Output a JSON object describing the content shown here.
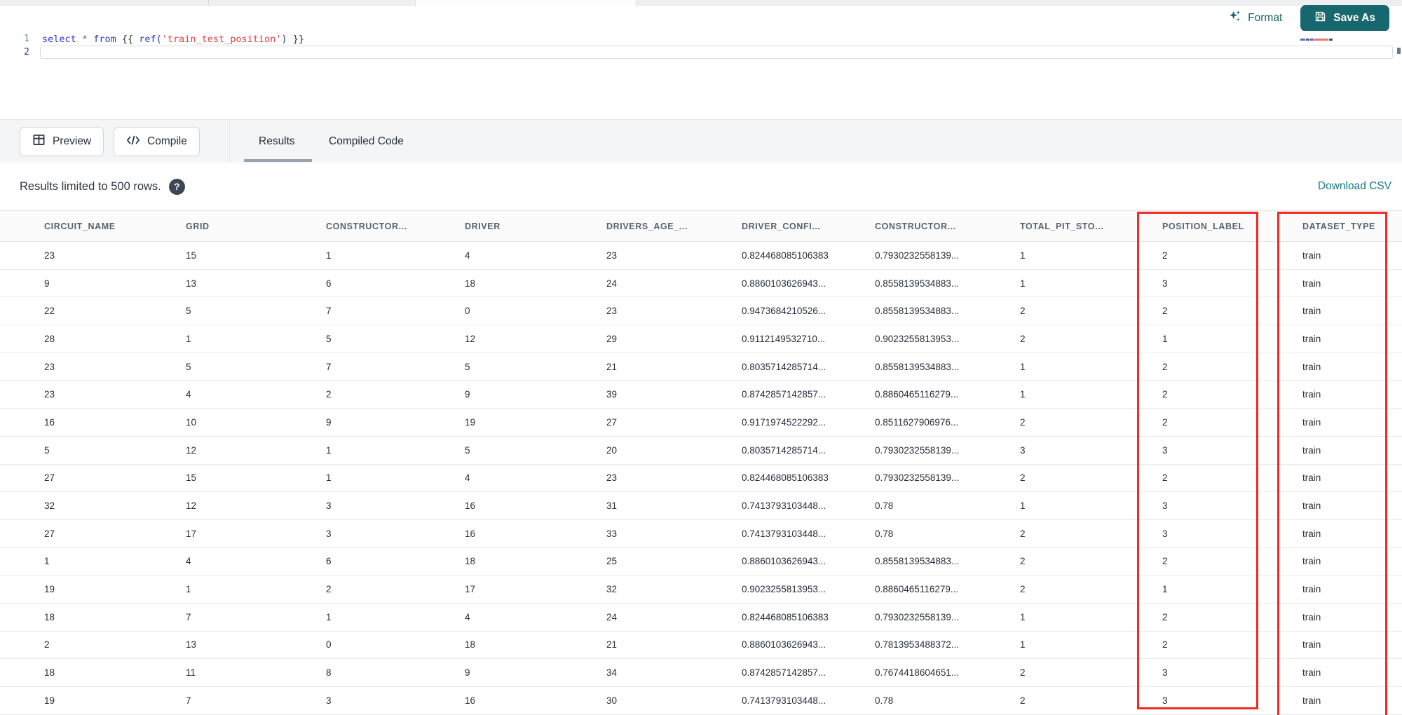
{
  "toolbar": {
    "format_label": "Format",
    "save_as_label": "Save As"
  },
  "editor": {
    "line1_number": "1",
    "line2_number": "2",
    "code_tokens": [
      {
        "text": "select",
        "type": "keyword"
      },
      {
        "text": " ",
        "type": "plain"
      },
      {
        "text": "*",
        "type": "operator"
      },
      {
        "text": " ",
        "type": "plain"
      },
      {
        "text": "from",
        "type": "keyword"
      },
      {
        "text": " {{ ",
        "type": "plain"
      },
      {
        "text": "ref(",
        "type": "keyword"
      },
      {
        "text": "'train_test_position'",
        "type": "string"
      },
      {
        "text": ")",
        "type": "plain"
      },
      {
        "text": " }}",
        "type": "plain"
      }
    ]
  },
  "results_bar": {
    "preview_label": "Preview",
    "compile_label": "Compile",
    "tabs": [
      {
        "label": "Results",
        "active": true
      },
      {
        "label": "Compiled Code",
        "active": false
      }
    ]
  },
  "info_bar": {
    "message": "Results limited to 500 rows.",
    "help_icon": "?",
    "download_label": "Download CSV"
  },
  "table": {
    "columns": [
      "CIRCUIT_NAME",
      "GRID",
      "CONSTRUCTOR...",
      "DRIVER",
      "DRIVERS_AGE_...",
      "DRIVER_CONFI...",
      "CONSTRUCTOR...",
      "TOTAL_PIT_STO...",
      "POSITION_LABEL",
      "DATASET_TYPE"
    ],
    "rows": [
      [
        "23",
        "15",
        "1",
        "4",
        "23",
        "0.824468085106383",
        "0.7930232558139...",
        "1",
        "2",
        "train"
      ],
      [
        "9",
        "13",
        "6",
        "18",
        "24",
        "0.8860103626943...",
        "0.8558139534883...",
        "1",
        "3",
        "train"
      ],
      [
        "22",
        "5",
        "7",
        "0",
        "23",
        "0.9473684210526...",
        "0.8558139534883...",
        "2",
        "2",
        "train"
      ],
      [
        "28",
        "1",
        "5",
        "12",
        "29",
        "0.9112149532710...",
        "0.9023255813953...",
        "2",
        "1",
        "train"
      ],
      [
        "23",
        "5",
        "7",
        "5",
        "21",
        "0.8035714285714...",
        "0.8558139534883...",
        "1",
        "2",
        "train"
      ],
      [
        "23",
        "4",
        "2",
        "9",
        "39",
        "0.8742857142857...",
        "0.8860465116279...",
        "1",
        "2",
        "train"
      ],
      [
        "16",
        "10",
        "9",
        "19",
        "27",
        "0.9171974522292...",
        "0.8511627906976...",
        "2",
        "2",
        "train"
      ],
      [
        "5",
        "12",
        "1",
        "5",
        "20",
        "0.8035714285714...",
        "0.7930232558139...",
        "3",
        "3",
        "train"
      ],
      [
        "27",
        "15",
        "1",
        "4",
        "23",
        "0.824468085106383",
        "0.7930232558139...",
        "2",
        "2",
        "train"
      ],
      [
        "32",
        "12",
        "3",
        "16",
        "31",
        "0.7413793103448...",
        "0.78",
        "1",
        "3",
        "train"
      ],
      [
        "27",
        "17",
        "3",
        "16",
        "33",
        "0.7413793103448...",
        "0.78",
        "2",
        "3",
        "train"
      ],
      [
        "1",
        "4",
        "6",
        "18",
        "25",
        "0.8860103626943...",
        "0.8558139534883...",
        "2",
        "2",
        "train"
      ],
      [
        "19",
        "1",
        "2",
        "17",
        "32",
        "0.9023255813953...",
        "0.8860465116279...",
        "2",
        "1",
        "train"
      ],
      [
        "18",
        "7",
        "1",
        "4",
        "24",
        "0.824468085106383",
        "0.7930232558139...",
        "1",
        "2",
        "train"
      ],
      [
        "2",
        "13",
        "0",
        "18",
        "21",
        "0.8860103626943...",
        "0.7813953488372...",
        "1",
        "2",
        "train"
      ],
      [
        "18",
        "11",
        "8",
        "9",
        "34",
        "0.8742857142857...",
        "0.7674418604651...",
        "2",
        "3",
        "train"
      ],
      [
        "19",
        "7",
        "3",
        "16",
        "30",
        "0.7413793103448...",
        "0.78",
        "2",
        "3",
        "train"
      ]
    ],
    "annotated_columns": [
      "POSITION_LABEL",
      "DATASET_TYPE"
    ]
  },
  "colors": {
    "brand_teal": "#16686e",
    "link_teal": "#177683",
    "annotation_red": "#ee2b23"
  }
}
